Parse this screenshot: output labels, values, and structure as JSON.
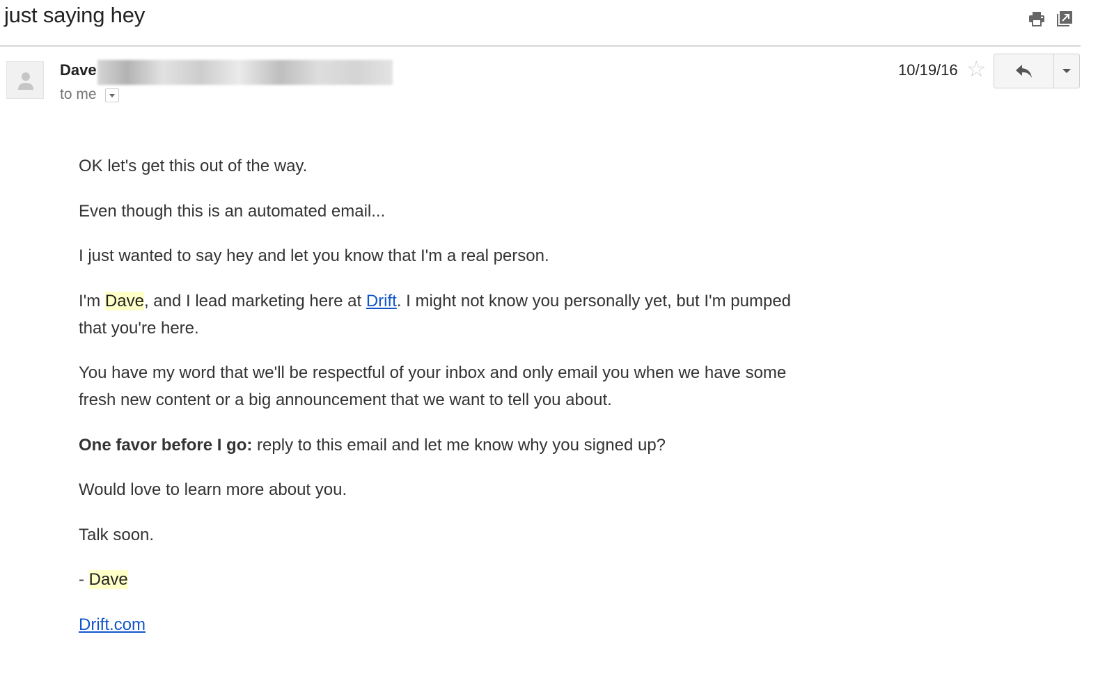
{
  "email": {
    "subject": "just saying hey",
    "toolbar": {
      "print_icon": "print-icon",
      "open_new_window_icon": "open-in-new-window-icon"
    },
    "sender": {
      "name": "Dave",
      "avatar_icon": "person-icon",
      "recipient_label": "to me",
      "recipient_dropdown_icon": "chevron-down-icon"
    },
    "date": "10/19/16",
    "star_icon": "star-outline-icon",
    "reply_icon": "reply-icon",
    "more_icon": "caret-down-icon",
    "body": {
      "p1": "OK let's get this out of the way.",
      "p2": "Even though this is an automated email...",
      "p3": "I just wanted to say hey and let you know that I'm a real person.",
      "p4_pre": "I'm ",
      "p4_name": "Dave",
      "p4_mid": ", and I lead marketing here at ",
      "p4_link": "Drift",
      "p4_post": ". I might not know you personally yet, but I'm pumped that you're here.",
      "p5": "You have my word that we'll be respectful of your inbox and only email you when we have some fresh new content or a big announcement that we want to tell you about.",
      "p6_bold": "One favor before I go:",
      "p6_rest": " reply to this email and let me know why you signed up?",
      "p7": "Would love to learn more about you.",
      "p8": "Talk soon.",
      "sig_dash": "- ",
      "sig_name": "Dave",
      "footer_link": "Drift.com"
    },
    "colors": {
      "link": "#1155cc",
      "highlight": "#ffffc8"
    }
  }
}
